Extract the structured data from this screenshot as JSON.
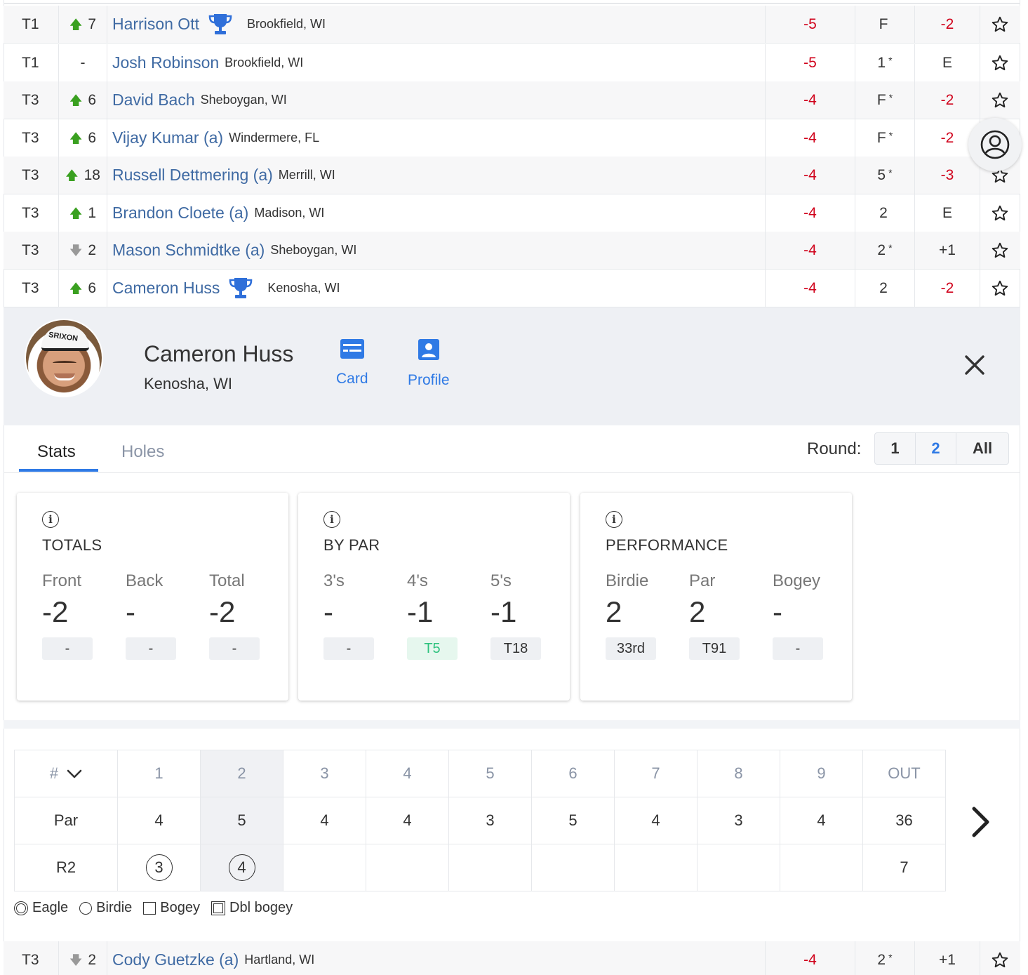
{
  "leaderboard": [
    {
      "pos": "T1",
      "move_dir": "up",
      "move": "7",
      "name": "Harrison Ott",
      "trophy": true,
      "loc": "Brookfield, WI",
      "total": "-5",
      "thru": "F",
      "thru_star": "",
      "today": "-2",
      "today_red": true
    },
    {
      "pos": "T1",
      "move_dir": "none",
      "move": "-",
      "name": "Josh Robinson",
      "trophy": false,
      "loc": "Brookfield, WI",
      "total": "-5",
      "thru": "1",
      "thru_star": "*",
      "today": "E",
      "today_red": false
    },
    {
      "pos": "T3",
      "move_dir": "up",
      "move": "6",
      "name": "David Bach",
      "trophy": false,
      "loc": "Sheboygan, WI",
      "total": "-4",
      "thru": "F",
      "thru_star": "*",
      "today": "-2",
      "today_red": true
    },
    {
      "pos": "T3",
      "move_dir": "up",
      "move": "6",
      "name": "Vijay Kumar (a)",
      "trophy": false,
      "loc": "Windermere, FL",
      "total": "-4",
      "thru": "F",
      "thru_star": "*",
      "today": "-2",
      "today_red": true
    },
    {
      "pos": "T3",
      "move_dir": "up",
      "move": "18",
      "name": "Russell Dettmering (a)",
      "trophy": false,
      "loc": "Merrill, WI",
      "total": "-4",
      "thru": "5",
      "thru_star": "*",
      "today": "-3",
      "today_red": true
    },
    {
      "pos": "T3",
      "move_dir": "up",
      "move": "1",
      "name": "Brandon Cloete (a)",
      "trophy": false,
      "loc": "Madison, WI",
      "total": "-4",
      "thru": "2",
      "thru_star": "",
      "today": "E",
      "today_red": false
    },
    {
      "pos": "T3",
      "move_dir": "down",
      "move": "2",
      "name": "Mason Schmidtke (a)",
      "trophy": false,
      "loc": "Sheboygan, WI",
      "total": "-4",
      "thru": "2",
      "thru_star": "*",
      "today": "+1",
      "today_red": false
    },
    {
      "pos": "T3",
      "move_dir": "up",
      "move": "6",
      "name": "Cameron Huss",
      "trophy": true,
      "loc": "Kenosha, WI",
      "total": "-4",
      "thru": "2",
      "thru_star": "",
      "today": "-2",
      "today_red": true
    }
  ],
  "bottom_row": {
    "pos": "T3",
    "move_dir": "down",
    "move": "2",
    "name": "Cody Guetzke (a)",
    "trophy": false,
    "loc": "Hartland, WI",
    "total": "-4",
    "thru": "2",
    "thru_star": "*",
    "today": "+1",
    "today_red": false
  },
  "player": {
    "name": "Cameron Huss",
    "location": "Kenosha, WI",
    "cap_text": "SRIXON",
    "card_label": "Card",
    "profile_label": "Profile"
  },
  "tabs": {
    "stats": "Stats",
    "holes": "Holes",
    "round_label": "Round:",
    "rounds": [
      "1",
      "2",
      "All"
    ],
    "selected_round": "2"
  },
  "cards": [
    {
      "title": "TOTALS",
      "stats": [
        {
          "label": "Front",
          "value": "-2",
          "badge": "-",
          "green": false
        },
        {
          "label": "Back",
          "value": "-",
          "badge": "-",
          "green": false
        },
        {
          "label": "Total",
          "value": "-2",
          "badge": "-",
          "green": false
        }
      ]
    },
    {
      "title": "BY PAR",
      "stats": [
        {
          "label": "3's",
          "value": "-",
          "badge": "-",
          "green": false
        },
        {
          "label": "4's",
          "value": "-1",
          "badge": "T5",
          "green": true
        },
        {
          "label": "5's",
          "value": "-1",
          "badge": "T18",
          "green": false
        }
      ]
    },
    {
      "title": "PERFORMANCE",
      "stats": [
        {
          "label": "Birdie",
          "value": "2",
          "badge": "33rd",
          "green": false
        },
        {
          "label": "Par",
          "value": "2",
          "badge": "T91",
          "green": false
        },
        {
          "label": "Bogey",
          "value": "-",
          "badge": "-",
          "green": false
        }
      ]
    }
  ],
  "scorecard": {
    "hash_label": "#",
    "holes": [
      "1",
      "2",
      "3",
      "4",
      "5",
      "6",
      "7",
      "8",
      "9",
      "OUT"
    ],
    "par_label": "Par",
    "par": [
      "4",
      "5",
      "4",
      "4",
      "3",
      "5",
      "4",
      "3",
      "4",
      "36"
    ],
    "round_label": "R2",
    "scores": [
      "3",
      "4",
      "",
      "",
      "",
      "",
      "",
      "",
      "",
      "7"
    ],
    "circled": [
      true,
      true,
      false,
      false,
      false,
      false,
      false,
      false,
      false,
      false
    ]
  },
  "legend": {
    "eagle": "Eagle",
    "birdie": "Birdie",
    "bogey": "Bogey",
    "dbl_bogey": "Dbl bogey"
  },
  "colors": {
    "link": "#3f6aa3",
    "accent": "#2f7ae5",
    "red": "#d0021b",
    "green_up": "#3aa020"
  }
}
